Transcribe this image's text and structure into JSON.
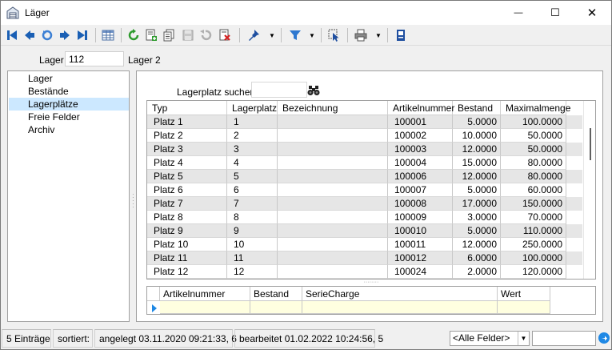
{
  "window": {
    "title": "Läger",
    "minimize_glyph": "—",
    "maximize_glyph": "☐",
    "close_glyph": "✕"
  },
  "toolbar": {
    "icons": [
      "first-record-icon",
      "prev-record-icon",
      "refresh-record-icon",
      "next-record-icon",
      "last-record-icon",
      "table-view-icon",
      "reload-icon",
      "new-record-icon",
      "copy-record-icon",
      "save-icon",
      "undo-icon",
      "delete-icon",
      "pin-icon",
      "filter-icon",
      "select-icon",
      "print-icon",
      "info-icon"
    ]
  },
  "header": {
    "lager_label": "Lager",
    "lager_value": "112",
    "lager_name": "Lager 2"
  },
  "nav": {
    "items": [
      {
        "label": "Lager"
      },
      {
        "label": "Bestände"
      },
      {
        "label": "Lagerplätze"
      },
      {
        "label": "Freie Felder"
      },
      {
        "label": "Archiv"
      }
    ],
    "selected_index": 2
  },
  "search": {
    "label": "Lagerplatz suchen"
  },
  "grid": {
    "columns": [
      "Typ",
      "Lagerplatz",
      "Bezeichnung",
      "Artikelnummer",
      "Bestand",
      "Maximalmenge"
    ],
    "rows": [
      [
        "Platz 1",
        "1",
        "",
        "100001",
        "5.0000",
        "100.0000"
      ],
      [
        "Platz 2",
        "2",
        "",
        "100002",
        "10.0000",
        "50.0000"
      ],
      [
        "Platz 3",
        "3",
        "",
        "100003",
        "12.0000",
        "50.0000"
      ],
      [
        "Platz 4",
        "4",
        "",
        "100004",
        "15.0000",
        "80.0000"
      ],
      [
        "Platz 5",
        "5",
        "",
        "100006",
        "12.0000",
        "80.0000"
      ],
      [
        "Platz 6",
        "6",
        "",
        "100007",
        "5.0000",
        "60.0000"
      ],
      [
        "Platz 7",
        "7",
        "",
        "100008",
        "17.0000",
        "150.0000"
      ],
      [
        "Platz 8",
        "8",
        "",
        "100009",
        "3.0000",
        "70.0000"
      ],
      [
        "Platz 9",
        "9",
        "",
        "100010",
        "5.0000",
        "110.0000"
      ],
      [
        "Platz 10",
        "10",
        "",
        "100011",
        "12.0000",
        "250.0000"
      ],
      [
        "Platz 11",
        "11",
        "",
        "100012",
        "6.0000",
        "100.0000"
      ],
      [
        "Platz 12",
        "12",
        "",
        "100024",
        "2.0000",
        "120.0000"
      ]
    ]
  },
  "subgrid": {
    "columns": [
      "Artikelnummer",
      "Bestand",
      "SerieCharge",
      "Wert"
    ]
  },
  "status": {
    "count": "5 Einträge",
    "sorted": "sortiert:",
    "created": "angelegt 03.11.2020 09:21:33,  6",
    "edited": "bearbeitet 01.02.2022 10:24:56,  5",
    "field_combo": "<Alle Felder>"
  },
  "colors": {
    "selected_nav": "#cce8ff",
    "row_alt": "#e6e6e6",
    "subgrid_row": "#ffffe0",
    "accent_blue": "#1a5fb4"
  }
}
